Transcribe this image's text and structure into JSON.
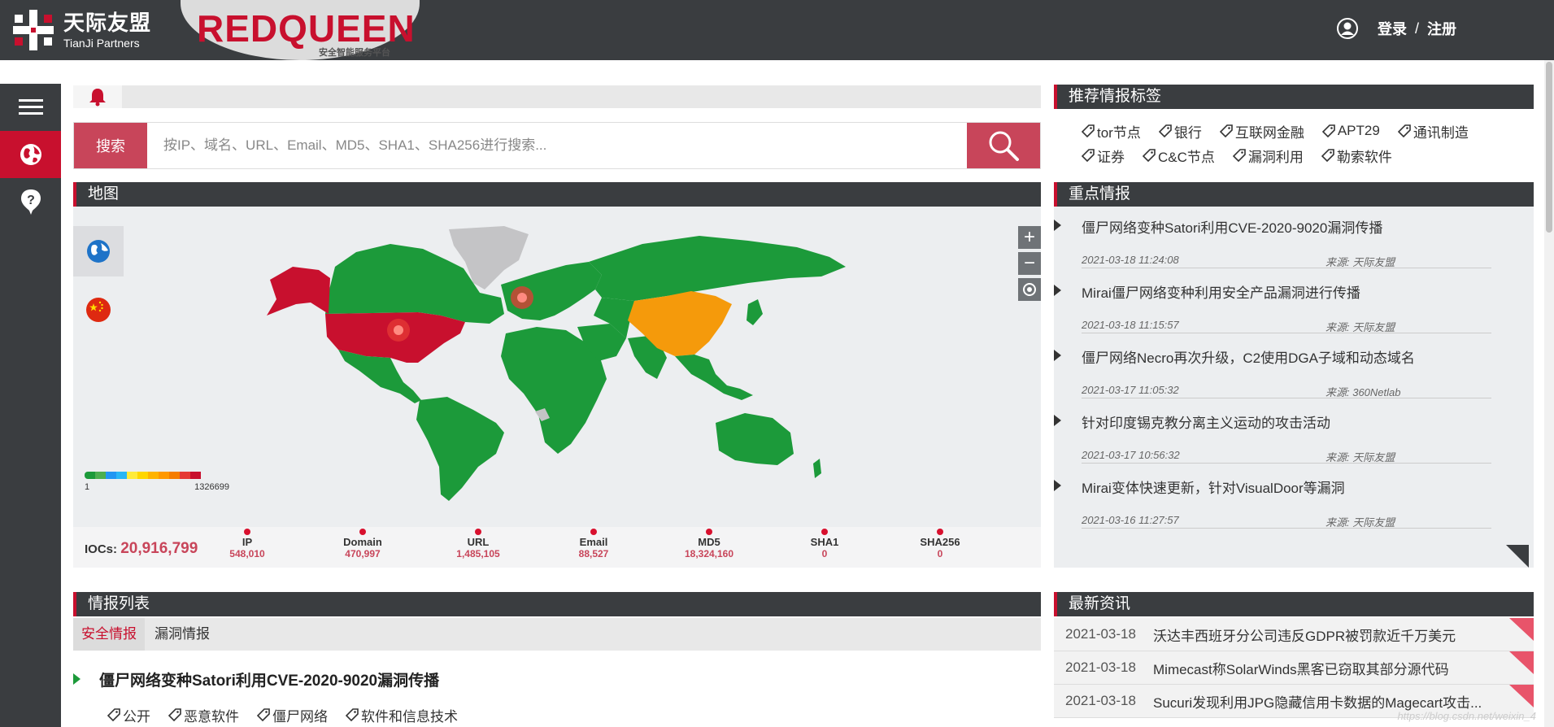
{
  "header": {
    "brand_cn": "天际友盟",
    "brand_en": "TianJi Partners",
    "product_name": "REDQUEEN",
    "product_sub": "安全智能服务平台",
    "login": "登录",
    "separator": "/",
    "register": "注册"
  },
  "search": {
    "label": "搜索",
    "placeholder": "按IP、域名、URL、Email、MD5、SHA1、SHA256进行搜索..."
  },
  "map_panel": {
    "title": "地图",
    "zoom_in": "+",
    "zoom_out": "−",
    "legend_min": "1",
    "legend_max": "1326699",
    "legend_colors": [
      "#1c9a3a",
      "#4caf50",
      "#2196f3",
      "#29b6f6",
      "#ffeb3b",
      "#ffd600",
      "#ffb300",
      "#ff9800",
      "#f57c00",
      "#e53935",
      "#c8102e"
    ],
    "iocs_label": "IOCs:",
    "iocs_total": "20,916,799",
    "stats": [
      {
        "name": "IP",
        "value": "548,010"
      },
      {
        "name": "Domain",
        "value": "470,997"
      },
      {
        "name": "URL",
        "value": "1,485,105"
      },
      {
        "name": "Email",
        "value": "88,527"
      },
      {
        "name": "MD5",
        "value": "18,324,160"
      },
      {
        "name": "SHA1",
        "value": "0"
      },
      {
        "name": "SHA256",
        "value": "0"
      }
    ]
  },
  "tags_panel": {
    "title": "推荐情报标签",
    "tags": [
      "tor节点",
      "银行",
      "互联网金融",
      "APT29",
      "通讯制造",
      "证券",
      "C&C节点",
      "漏洞利用",
      "勒索软件"
    ]
  },
  "key_intel": {
    "title": "重点情报",
    "items": [
      {
        "title": "僵尸网络变种Satori利用CVE-2020-9020漏洞传播",
        "time": "2021-03-18 11:24:08",
        "source": "来源: 天际友盟"
      },
      {
        "title": "Mirai僵尸网络变种利用安全产品漏洞进行传播",
        "time": "2021-03-18 11:15:57",
        "source": "来源: 天际友盟"
      },
      {
        "title": "僵尸网络Necro再次升级，C2使用DGA子域和动态域名",
        "time": "2021-03-17 11:05:32",
        "source": "来源: 360Netlab"
      },
      {
        "title": "针对印度锡克教分离主义运动的攻击活动",
        "time": "2021-03-17 10:56:32",
        "source": "来源: 天际友盟"
      },
      {
        "title": "Mirai变体快速更新，针对VisualDoor等漏洞",
        "time": "2021-03-16 11:27:57",
        "source": "来源: 天际友盟"
      }
    ]
  },
  "intel_list": {
    "title": "情报列表",
    "tabs": [
      "安全情报",
      "漏洞情报"
    ],
    "first_item": {
      "title": "僵尸网络变种Satori利用CVE-2020-9020漏洞传播",
      "tags": [
        "公开",
        "恶意软件",
        "僵尸网络",
        "软件和信息技术"
      ]
    }
  },
  "latest_news": {
    "title": "最新资讯",
    "items": [
      {
        "date": "2021-03-18",
        "title": "沃达丰西班牙分公司违反GDPR被罚款近千万美元"
      },
      {
        "date": "2021-03-18",
        "title": "Mimecast称SolarWinds黑客已窃取其部分源代码"
      },
      {
        "date": "2021-03-18",
        "title": "Sucuri发现利用JPG隐藏信用卡数据的Magecart攻击..."
      }
    ]
  },
  "watermark": "https://blog.csdn.net/weixin_4"
}
